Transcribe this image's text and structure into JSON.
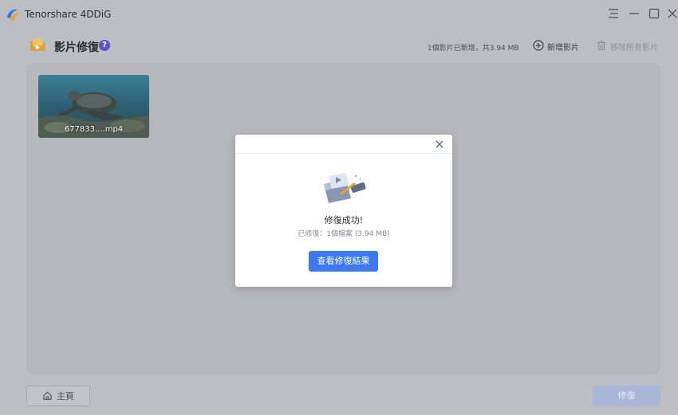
{
  "app": {
    "title": "Tenorshare 4DDiG"
  },
  "window_controls": [
    {
      "name": "menu-icon"
    },
    {
      "name": "minimize-icon"
    },
    {
      "name": "maximize-icon"
    },
    {
      "name": "close-icon"
    }
  ],
  "header": {
    "icon": "video-folder-icon",
    "title": "影片修復",
    "help_label": "?",
    "stats": "1個影片已新增，共3.94 MB",
    "add_label": "新增影片",
    "remove_label": "移除所有影片"
  },
  "videos": [
    {
      "filename": "677833....mp4"
    }
  ],
  "footer": {
    "home_label": "主頁",
    "repair_label": "修復"
  },
  "dialog": {
    "title": "修復成功!",
    "detail": "已修復：1個檔案 (3.94 MB)",
    "button_label": "查看修復結果"
  },
  "colors": {
    "accent": "#3d79f2",
    "overlay_bg": "#bcbec4",
    "help_badge": "#5a56c8"
  }
}
